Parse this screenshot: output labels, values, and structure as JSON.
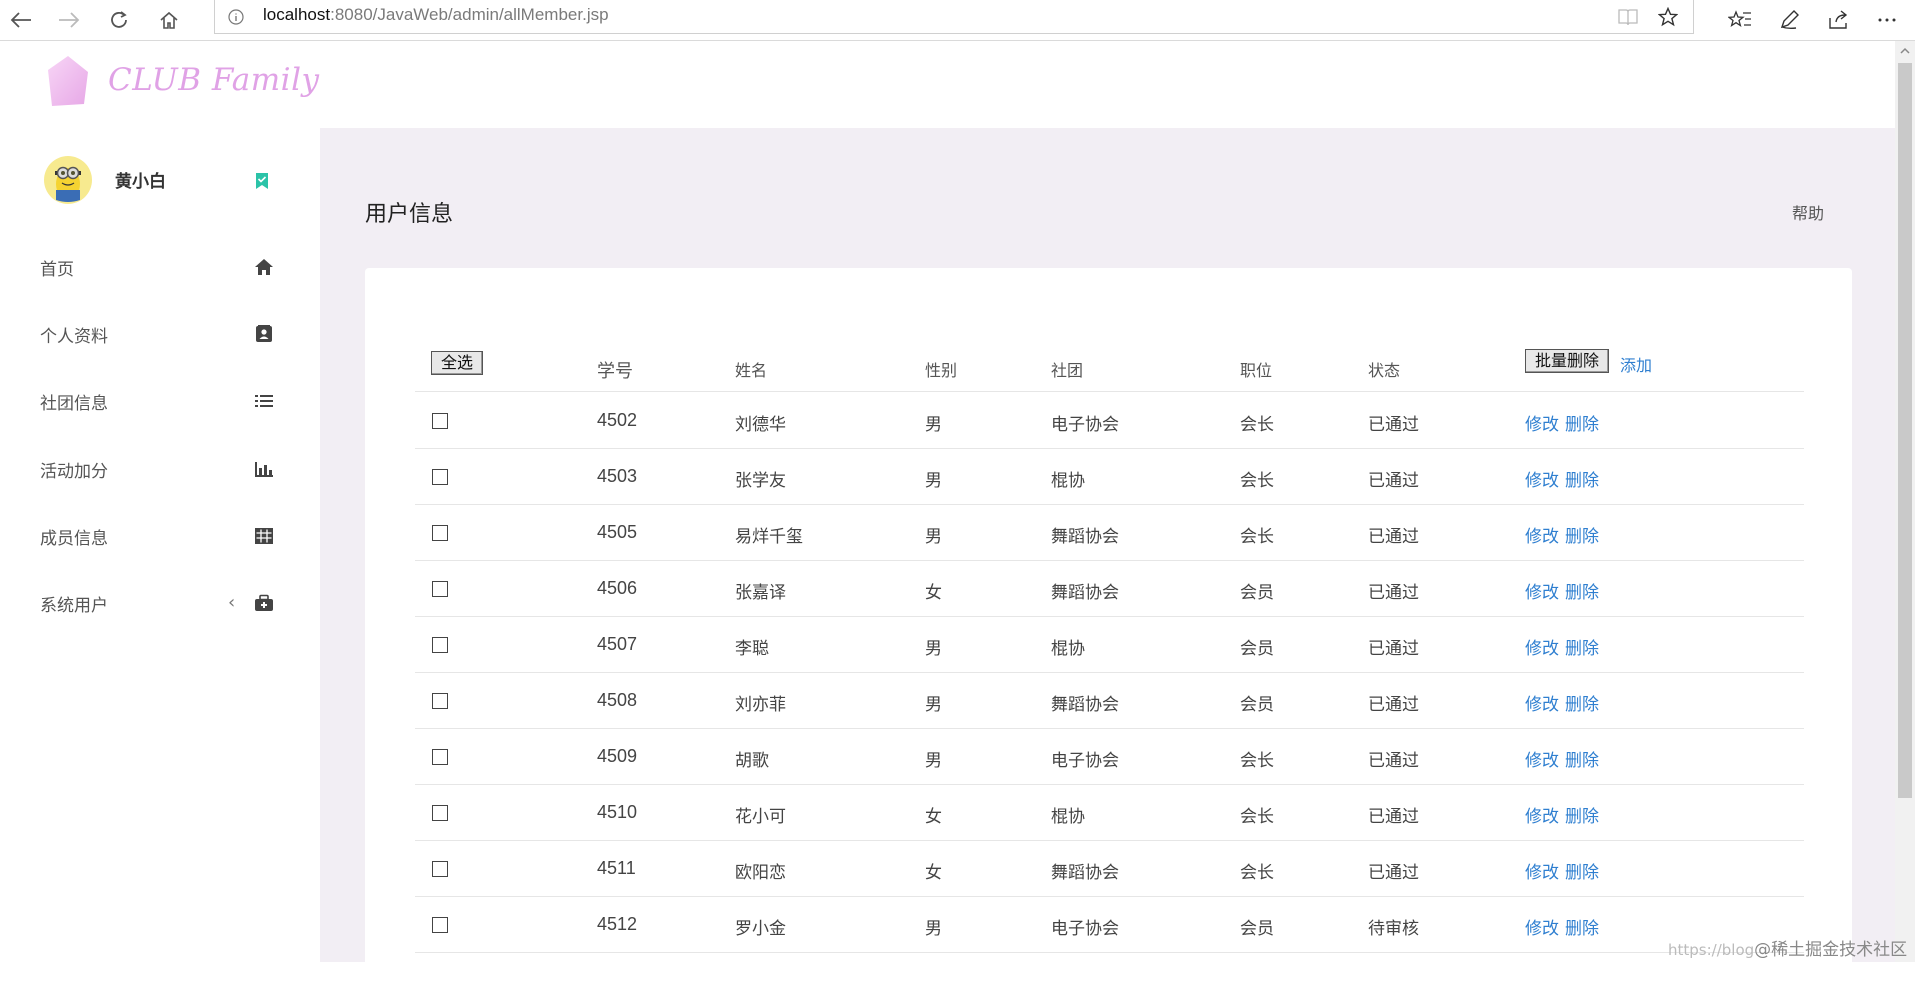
{
  "browser": {
    "url_host": "localhost",
    "url_rest": ":8080/JavaWeb/admin/allMember.jsp"
  },
  "logo": {
    "text": "CLUB Family"
  },
  "user": {
    "name": "黄小白"
  },
  "sidebar": {
    "items": [
      {
        "label": "首页",
        "icon": "home-icon"
      },
      {
        "label": "个人资料",
        "icon": "contact-card-icon"
      },
      {
        "label": "社团信息",
        "icon": "list-icon"
      },
      {
        "label": "活动加分",
        "icon": "bar-chart-icon"
      },
      {
        "label": "成员信息",
        "icon": "table-icon"
      },
      {
        "label": "系统用户",
        "icon": "medical-bag-icon"
      }
    ]
  },
  "main": {
    "title": "用户信息",
    "help": "帮助"
  },
  "table": {
    "select_all": "全选",
    "batch_delete": "批量删除",
    "add": "添加",
    "headers": {
      "id": "学号",
      "name": "姓名",
      "gender": "性别",
      "club": "社团",
      "position": "职位",
      "status": "状态"
    },
    "edit_label": "修改",
    "delete_label": "删除",
    "rows": [
      {
        "id": "4502",
        "name": "刘德华",
        "gender": "男",
        "club": "电子协会",
        "position": "会长",
        "status": "已通过"
      },
      {
        "id": "4503",
        "name": "张学友",
        "gender": "男",
        "club": "棍协",
        "position": "会长",
        "status": "已通过"
      },
      {
        "id": "4505",
        "name": "易烊千玺",
        "gender": "男",
        "club": "舞蹈协会",
        "position": "会长",
        "status": "已通过"
      },
      {
        "id": "4506",
        "name": "张嘉译",
        "gender": "女",
        "club": "舞蹈协会",
        "position": "会员",
        "status": "已通过"
      },
      {
        "id": "4507",
        "name": "李聪",
        "gender": "男",
        "club": "棍协",
        "position": "会员",
        "status": "已通过"
      },
      {
        "id": "4508",
        "name": "刘亦菲",
        "gender": "男",
        "club": "舞蹈协会",
        "position": "会员",
        "status": "已通过"
      },
      {
        "id": "4509",
        "name": "胡歌",
        "gender": "男",
        "club": "电子协会",
        "position": "会长",
        "status": "已通过"
      },
      {
        "id": "4510",
        "name": "花小可",
        "gender": "女",
        "club": "棍协",
        "position": "会长",
        "status": "已通过"
      },
      {
        "id": "4511",
        "name": "欧阳恋",
        "gender": "女",
        "club": "舞蹈协会",
        "position": "会长",
        "status": "已通过"
      },
      {
        "id": "4512",
        "name": "罗小金",
        "gender": "男",
        "club": "电子协会",
        "position": "会员",
        "status": "待审核"
      }
    ]
  },
  "watermark": {
    "prefix": "https://blog",
    "text": "@稀土掘金技术社区"
  },
  "colors": {
    "link": "#2f7fd0",
    "main_bg": "#f2eef4",
    "logo": "#e0a2e6",
    "status_ok": "#2bc3a8"
  }
}
